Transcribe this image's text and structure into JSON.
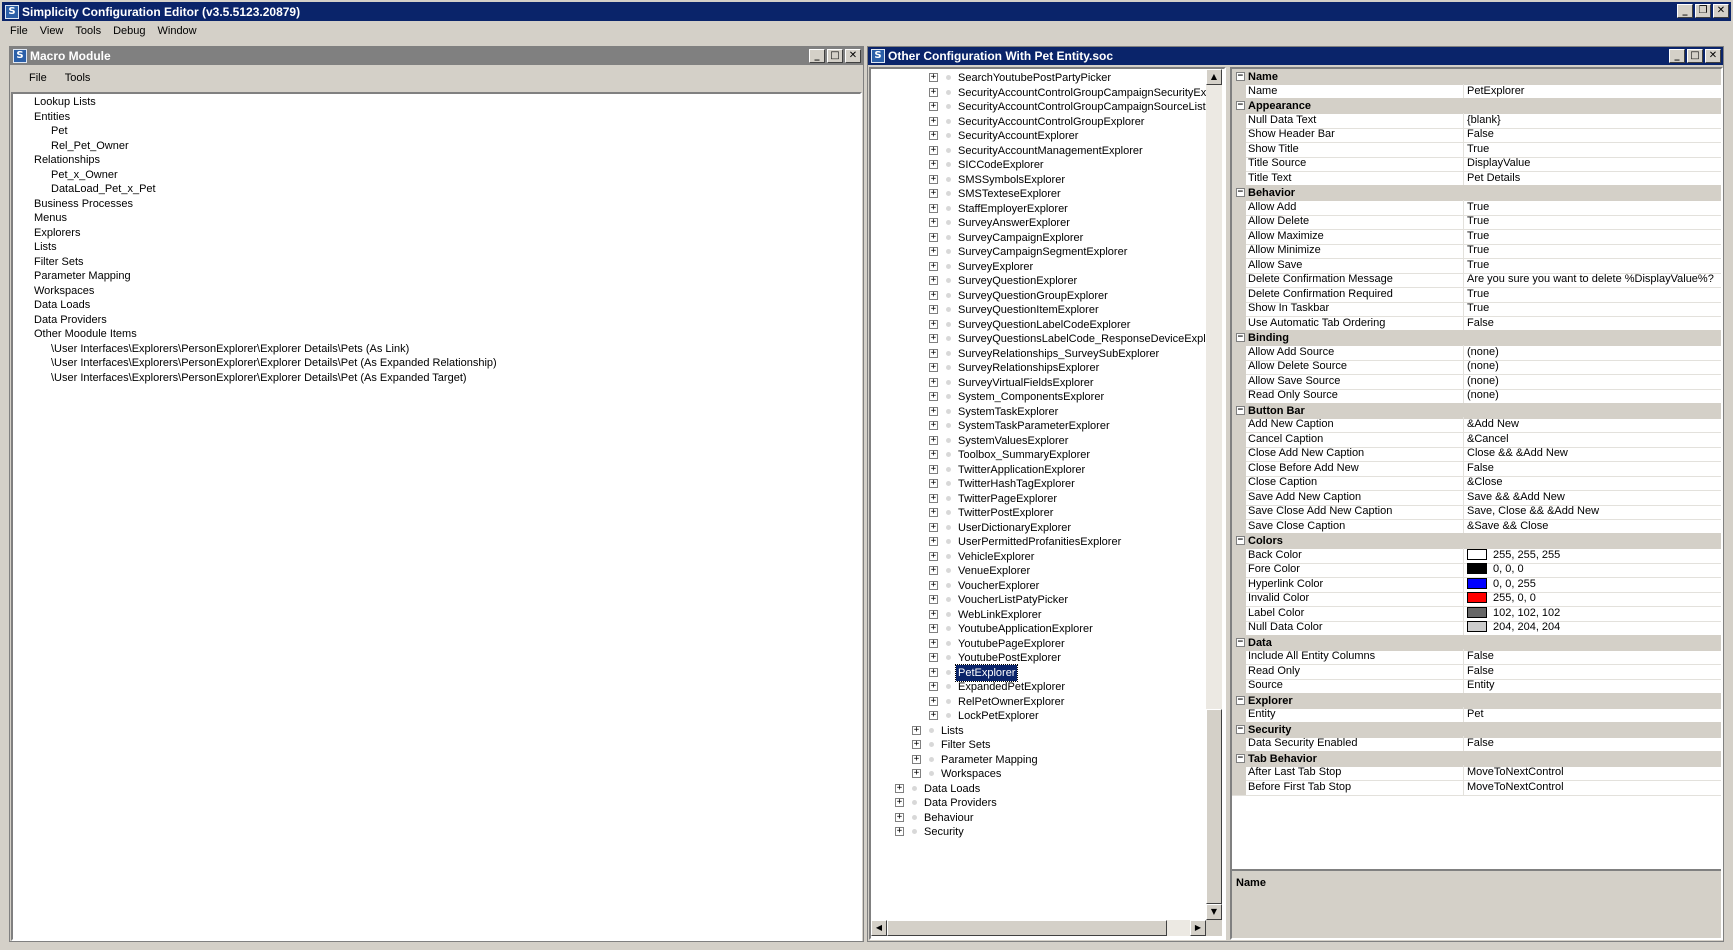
{
  "app": {
    "title": "Simplicity Configuration Editor (v3.5.5123.20879)",
    "menu": [
      "File",
      "View",
      "Tools",
      "Debug",
      "Window"
    ]
  },
  "macro": {
    "title": "Macro Module",
    "menu": [
      "File",
      "Tools"
    ],
    "items": [
      {
        "label": "Lookup Lists",
        "level": 0
      },
      {
        "label": "Entities",
        "level": 0
      },
      {
        "label": "Pet",
        "level": 1
      },
      {
        "label": "Rel_Pet_Owner",
        "level": 1
      },
      {
        "label": "Relationships",
        "level": 0
      },
      {
        "label": "Pet_x_Owner",
        "level": 1
      },
      {
        "label": "DataLoad_Pet_x_Pet",
        "level": 1
      },
      {
        "label": "Business Processes",
        "level": 0
      },
      {
        "label": "Menus",
        "level": 0
      },
      {
        "label": "Explorers",
        "level": 0
      },
      {
        "label": "Lists",
        "level": 0
      },
      {
        "label": "Filter Sets",
        "level": 0
      },
      {
        "label": "Parameter Mapping",
        "level": 0
      },
      {
        "label": "Workspaces",
        "level": 0
      },
      {
        "label": "Data Loads",
        "level": 0
      },
      {
        "label": "Data Providers",
        "level": 0
      },
      {
        "label": "Other Moodule Items",
        "level": 0
      },
      {
        "label": "\\User Interfaces\\Explorers\\PersonExplorer\\Explorer Details\\Pets (As Link)",
        "level": 1
      },
      {
        "label": "\\User Interfaces\\Explorers\\PersonExplorer\\Explorer Details\\Pet (As Expanded Relationship)",
        "level": 1
      },
      {
        "label": "\\User Interfaces\\Explorers\\PersonExplorer\\Explorer Details\\Pet (As Expanded Target)",
        "level": 1
      }
    ]
  },
  "doc": {
    "title": "Other Configuration With Pet Entity.soc",
    "tree": [
      {
        "label": "SearchYoutubePostPartyPicker",
        "level": 2
      },
      {
        "label": "SecurityAccountControlGroupCampaignSecurityExp",
        "level": 2
      },
      {
        "label": "SecurityAccountControlGroupCampaignSourceListE",
        "level": 2
      },
      {
        "label": "SecurityAccountControlGroupExplorer",
        "level": 2
      },
      {
        "label": "SecurityAccountExplorer",
        "level": 2
      },
      {
        "label": "SecurityAccountManagementExplorer",
        "level": 2
      },
      {
        "label": "SICCodeExplorer",
        "level": 2
      },
      {
        "label": "SMSSymbolsExplorer",
        "level": 2
      },
      {
        "label": "SMSTexteseExplorer",
        "level": 2
      },
      {
        "label": "StaffEmployerExplorer",
        "level": 2
      },
      {
        "label": "SurveyAnswerExplorer",
        "level": 2
      },
      {
        "label": "SurveyCampaignExplorer",
        "level": 2
      },
      {
        "label": "SurveyCampaignSegmentExplorer",
        "level": 2
      },
      {
        "label": "SurveyExplorer",
        "level": 2
      },
      {
        "label": "SurveyQuestionExplorer",
        "level": 2
      },
      {
        "label": "SurveyQuestionGroupExplorer",
        "level": 2
      },
      {
        "label": "SurveyQuestionItemExplorer",
        "level": 2
      },
      {
        "label": "SurveyQuestionLabelCodeExplorer",
        "level": 2
      },
      {
        "label": "SurveyQuestionsLabelCode_ResponseDeviceExpl",
        "level": 2
      },
      {
        "label": "SurveyRelationships_SurveySubExplorer",
        "level": 2
      },
      {
        "label": "SurveyRelationshipsExplorer",
        "level": 2
      },
      {
        "label": "SurveyVirtualFieldsExplorer",
        "level": 2
      },
      {
        "label": "System_ComponentsExplorer",
        "level": 2
      },
      {
        "label": "SystemTaskExplorer",
        "level": 2
      },
      {
        "label": "SystemTaskParameterExplorer",
        "level": 2
      },
      {
        "label": "SystemValuesExplorer",
        "level": 2
      },
      {
        "label": "Toolbox_SummaryExplorer",
        "level": 2
      },
      {
        "label": "TwitterApplicationExplorer",
        "level": 2
      },
      {
        "label": "TwitterHashTagExplorer",
        "level": 2
      },
      {
        "label": "TwitterPageExplorer",
        "level": 2
      },
      {
        "label": "TwitterPostExplorer",
        "level": 2
      },
      {
        "label": "UserDictionaryExplorer",
        "level": 2
      },
      {
        "label": "UserPermittedProfanitiesExplorer",
        "level": 2
      },
      {
        "label": "VehicleExplorer",
        "level": 2
      },
      {
        "label": "VenueExplorer",
        "level": 2
      },
      {
        "label": "VoucherExplorer",
        "level": 2
      },
      {
        "label": "VoucherListPatyPicker",
        "level": 2
      },
      {
        "label": "WebLinkExplorer",
        "level": 2
      },
      {
        "label": "YoutubeApplicationExplorer",
        "level": 2
      },
      {
        "label": "YoutubePageExplorer",
        "level": 2
      },
      {
        "label": "YoutubePostExplorer",
        "level": 2
      },
      {
        "label": "PetExplorer",
        "level": 2,
        "selected": true
      },
      {
        "label": "ExpandedPetExplorer",
        "level": 2
      },
      {
        "label": "RelPetOwnerExplorer",
        "level": 2
      },
      {
        "label": "LockPetExplorer",
        "level": 2
      },
      {
        "label": "Lists",
        "level": 1
      },
      {
        "label": "Filter Sets",
        "level": 1
      },
      {
        "label": "Parameter Mapping",
        "level": 1
      },
      {
        "label": "Workspaces",
        "level": 1
      },
      {
        "label": "Data Loads",
        "level": 0
      },
      {
        "label": "Data Providers",
        "level": 0
      },
      {
        "label": "Behaviour",
        "level": 0
      },
      {
        "label": "Security",
        "level": 0
      }
    ]
  },
  "props": {
    "categories": [
      {
        "name": "Name",
        "rows": [
          [
            "Name",
            "PetExplorer"
          ]
        ]
      },
      {
        "name": "Appearance",
        "rows": [
          [
            "Null Data Text",
            "{blank}"
          ],
          [
            "Show Header Bar",
            "False"
          ],
          [
            "Show Title",
            "True"
          ],
          [
            "Title Source",
            "DisplayValue"
          ],
          [
            "Title Text",
            "Pet Details"
          ]
        ]
      },
      {
        "name": "Behavior",
        "rows": [
          [
            "Allow Add",
            "True"
          ],
          [
            "Allow Delete",
            "True"
          ],
          [
            "Allow Maximize",
            "True"
          ],
          [
            "Allow Minimize",
            "True"
          ],
          [
            "Allow Save",
            "True"
          ],
          [
            "Delete Confirmation Message",
            "Are you sure you want to delete %DisplayValue%?"
          ],
          [
            "Delete Confirmation Required",
            "True"
          ],
          [
            "Show In Taskbar",
            "True"
          ],
          [
            "Use Automatic Tab Ordering",
            "False"
          ]
        ]
      },
      {
        "name": "Binding",
        "rows": [
          [
            "Allow Add Source",
            "(none)"
          ],
          [
            "Allow Delete Source",
            "(none)"
          ],
          [
            "Allow Save Source",
            "(none)"
          ],
          [
            "Read Only Source",
            "(none)"
          ]
        ]
      },
      {
        "name": "Button Bar",
        "rows": [
          [
            "Add New Caption",
            "&Add New"
          ],
          [
            "Cancel Caption",
            "&Cancel"
          ],
          [
            "Close Add New Caption",
            "Close && &Add New"
          ],
          [
            "Close Before Add New",
            "False"
          ],
          [
            "Close Caption",
            "&Close"
          ],
          [
            "Save Add New Caption",
            "Save && &Add New"
          ],
          [
            "Save Close Add New Caption",
            "Save, Close && &Add New"
          ],
          [
            "Save Close Caption",
            "&Save && Close"
          ]
        ]
      },
      {
        "name": "Colors",
        "rows": [
          [
            "Back Color",
            "255, 255, 255",
            "#ffffff"
          ],
          [
            "Fore Color",
            "0, 0, 0",
            "#000000"
          ],
          [
            "Hyperlink Color",
            "0, 0, 255",
            "#0000ff"
          ],
          [
            "Invalid Color",
            "255, 0, 0",
            "#ff0000"
          ],
          [
            "Label Color",
            "102, 102, 102",
            "#666666"
          ],
          [
            "Null Data Color",
            "204, 204, 204",
            "#cccccc"
          ]
        ]
      },
      {
        "name": "Data",
        "rows": [
          [
            "Include All Entity Columns",
            "False"
          ],
          [
            "Read Only",
            "False"
          ],
          [
            "Source",
            "Entity"
          ]
        ]
      },
      {
        "name": "Explorer",
        "rows": [
          [
            "Entity",
            "Pet"
          ]
        ]
      },
      {
        "name": "Security",
        "rows": [
          [
            "Data Security Enabled",
            "False"
          ]
        ]
      },
      {
        "name": "Tab Behavior",
        "rows": [
          [
            "After Last Tab Stop",
            "MoveToNextControl"
          ],
          [
            "Before First Tab Stop",
            "MoveToNextControl"
          ]
        ]
      }
    ],
    "description_title": "Name"
  }
}
